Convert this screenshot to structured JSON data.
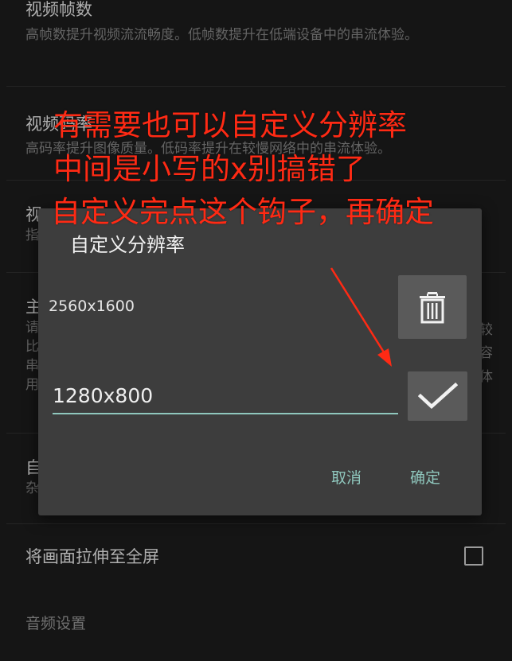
{
  "settings": {
    "frame_rate": {
      "title": "视频帧数",
      "desc": "高帧数提升视频流流畅度。低帧数提升在低端设备中的串流体验。"
    },
    "bitrate": {
      "title": "视频码率",
      "desc": "高码率提升图像质量。低码率提升在较慢网络中的串流体验。"
    },
    "partial_3": {
      "title": "视",
      "desc": "指"
    },
    "partial_4": {
      "title": "主",
      "desc_lines": [
        "请",
        "比",
        "串",
        "用"
      ],
      "right_chars": [
        "较",
        "容",
        "体"
      ]
    },
    "partial_5": {
      "title": "自",
      "desc": "杂"
    },
    "stretch": {
      "title": "将画面拉伸至全屏"
    },
    "audio_section": {
      "title": "音频设置"
    }
  },
  "dialog": {
    "title": "自定义分辨率",
    "existing_resolution": "2560x1600",
    "input_value": "1280x800",
    "cancel_label": "取消",
    "ok_label": "确定",
    "delete_icon": "trash-icon",
    "confirm_icon": "checkmark-icon"
  },
  "annotations": {
    "line1": "有需要也可以自定义分辨率",
    "line2": "中间是小写的x别搞错了",
    "line3": "自定义完点这个钩子，再确定",
    "color": "#ff2a14"
  },
  "colors": {
    "accent": "#8fc7bd",
    "dialog_bg": "#3d3d3d",
    "page_bg": "#1a1a1a"
  }
}
